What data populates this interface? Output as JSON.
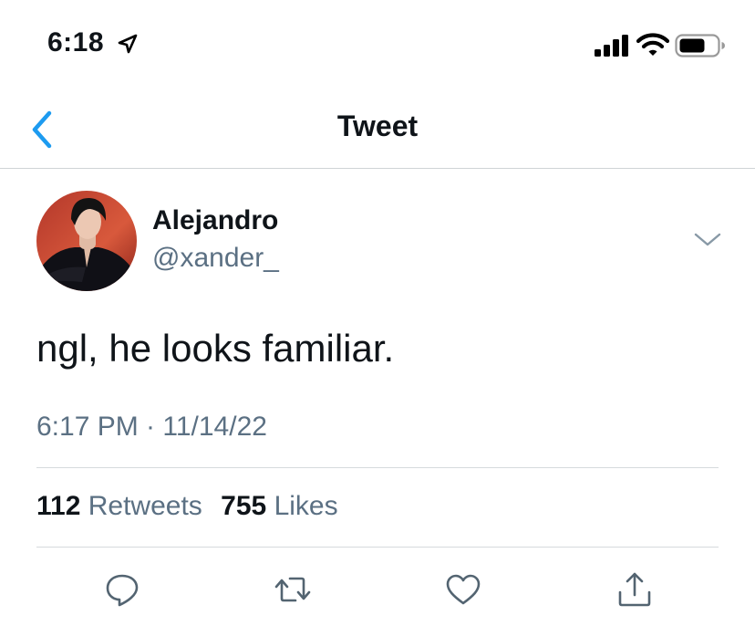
{
  "status_bar": {
    "time": "6:18",
    "icons": [
      "location-arrow-icon",
      "cellular-signal-icon",
      "wifi-icon",
      "battery-icon"
    ]
  },
  "nav": {
    "title": "Tweet",
    "back_icon": "chevron-left-icon"
  },
  "tweet": {
    "display_name": "Alejandro",
    "handle": "@xander_",
    "text": "ngl, he looks familiar.",
    "timestamp": "6:17 PM · 11/14/22",
    "retweet_count": "112",
    "retweet_label": "Retweets",
    "like_count": "755",
    "like_label": "Likes"
  },
  "actions": [
    "reply-icon",
    "retweet-icon",
    "like-icon",
    "share-icon"
  ],
  "colors": {
    "accent": "#1d9bf0",
    "text_primary": "#0f1419",
    "text_secondary": "#5b7083",
    "divider": "#d6dadd"
  }
}
